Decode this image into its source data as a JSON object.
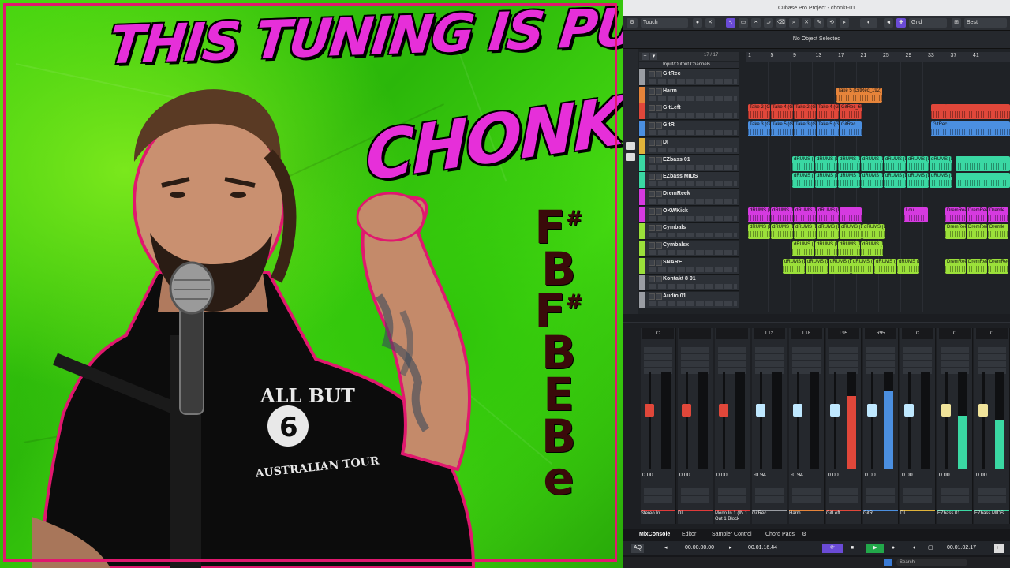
{
  "thumbnail": {
    "title_line1": "THIS TUNING IS PURE",
    "title_line2": "CHONK!!",
    "tuning_notes": [
      {
        "letter": "F",
        "sharp": "#"
      },
      {
        "letter": "B",
        "sharp": ""
      },
      {
        "letter": "F",
        "sharp": "#"
      },
      {
        "letter": "B",
        "sharp": ""
      },
      {
        "letter": "E",
        "sharp": ""
      },
      {
        "letter": "B",
        "sharp": ""
      },
      {
        "letter": "e",
        "sharp": ""
      }
    ],
    "shirt_text": [
      "ALL BUT",
      "6",
      "AUSTRALIAN TOUR"
    ],
    "colors": {
      "background": "#3fd30e",
      "title": "#e62fd9",
      "border": "#e0186e",
      "notes": "#3a0a0a"
    }
  },
  "daw": {
    "window_title": "Cubase Pro Project - chonkr-01",
    "toolbar": {
      "mode": "Touch",
      "grid": "Grid",
      "quantize": "Best"
    },
    "info_line": "No Object Selected",
    "track_count": "17 / 17",
    "folder_label": "Input/Output Channels",
    "ruler_bars": [
      "1",
      "5",
      "9",
      "13",
      "17",
      "21",
      "25",
      "29",
      "33",
      "37",
      "41"
    ],
    "tracks": [
      {
        "name": "GitRec",
        "color": "#9a9da3"
      },
      {
        "name": "Harm",
        "color": "#e6843a"
      },
      {
        "name": "GitLeft",
        "color": "#e0473a"
      },
      {
        "name": "GitR",
        "color": "#4b8fe0"
      },
      {
        "name": "DI",
        "color": "#e0b33a"
      },
      {
        "name": "EZbass 01",
        "color": "#3ad8a3"
      },
      {
        "name": "EZbass MIDS",
        "color": "#3ad8a3"
      },
      {
        "name": "DremReek",
        "color": "#d53ae0"
      },
      {
        "name": "OKWKick",
        "color": "#d53ae0"
      },
      {
        "name": "Cymbals",
        "color": "#9be03a"
      },
      {
        "name": "Cymbalsx",
        "color": "#9be03a"
      },
      {
        "name": "SNARE",
        "color": "#9be03a"
      },
      {
        "name": "Kontakt 8 01",
        "color": "#9a9da3"
      },
      {
        "name": "Audio 01",
        "color": "#9a9da3"
      }
    ],
    "clips": {
      "harm": "Take 5 (GitRec_192)",
      "gitleft": [
        "Take 2 (G",
        "Take 4 (G",
        "Take 2 (G",
        "Take 4 (G",
        "GitRec_60"
      ],
      "gitr": [
        "Take 3 (G",
        "Take 5 (G",
        "Take 3 (G",
        "Take 5 (G",
        "GitRec"
      ],
      "drums": "dRUMS (D)",
      "kick_extra": [
        "Lou",
        "Lou",
        "DremReel",
        "DremReel",
        "Dremle"
      ],
      "snare_first": "dRUMS (D) 11",
      "snare_extra": "DremReel"
    },
    "mixer": {
      "strips": [
        {
          "pan": "C",
          "value": "0.00",
          "label": "Stereo In",
          "num": "1",
          "color": "#e03a3a",
          "cap": "#e0473a",
          "level": 0.0
        },
        {
          "pan": "",
          "value": "0.00",
          "label": "DI",
          "num": "2",
          "color": "#e03a3a",
          "cap": "#e0473a",
          "level": 0.0
        },
        {
          "pan": "",
          "value": "0.00",
          "label": "Mono In 1 (IN 1 Out 1 Block",
          "num": "3",
          "color": "#e03a3a",
          "cap": "#e0473a",
          "level": 0.0
        },
        {
          "pan": "L12",
          "value": "-0.94",
          "label": "GitRec",
          "num": "1",
          "color": "#9a9da3",
          "cap": "#bfe8ff",
          "level": 0.0
        },
        {
          "pan": "L18",
          "value": "-0.94",
          "label": "Harm",
          "num": "2",
          "color": "#e6843a",
          "cap": "#bfe8ff",
          "level": 0.0
        },
        {
          "pan": "L95",
          "value": "0.00",
          "label": "GitLeft",
          "num": "3",
          "color": "#e0473a",
          "cap": "#bfe8ff",
          "level": 0.75
        },
        {
          "pan": "R95",
          "value": "0.00",
          "label": "GitR",
          "num": "4",
          "color": "#4b8fe0",
          "cap": "#bfe8ff",
          "level": 0.8
        },
        {
          "pan": "C",
          "value": "0.00",
          "label": "DI",
          "num": "5",
          "color": "#e0b33a",
          "cap": "#bfe8ff",
          "level": 0.0
        },
        {
          "pan": "C",
          "value": "0.00",
          "label": "EZbass 01",
          "num": "6",
          "color": "#3ad8a3",
          "cap": "#f0e39a",
          "level": 0.55
        },
        {
          "pan": "C",
          "value": "0.00",
          "label": "EZbass MIDS",
          "num": "7",
          "color": "#3ad8a3",
          "cap": "#f0e39a",
          "level": 0.5
        }
      ]
    },
    "bottom_tabs": [
      "MixConsole",
      "Editor",
      "Sampler Control",
      "Chord Pads"
    ],
    "transport": {
      "position": "00.00.00.00",
      "left_locator": "00.01.16.44",
      "right_locator": "00.01.02.17"
    },
    "taskbar_search": "Search"
  }
}
